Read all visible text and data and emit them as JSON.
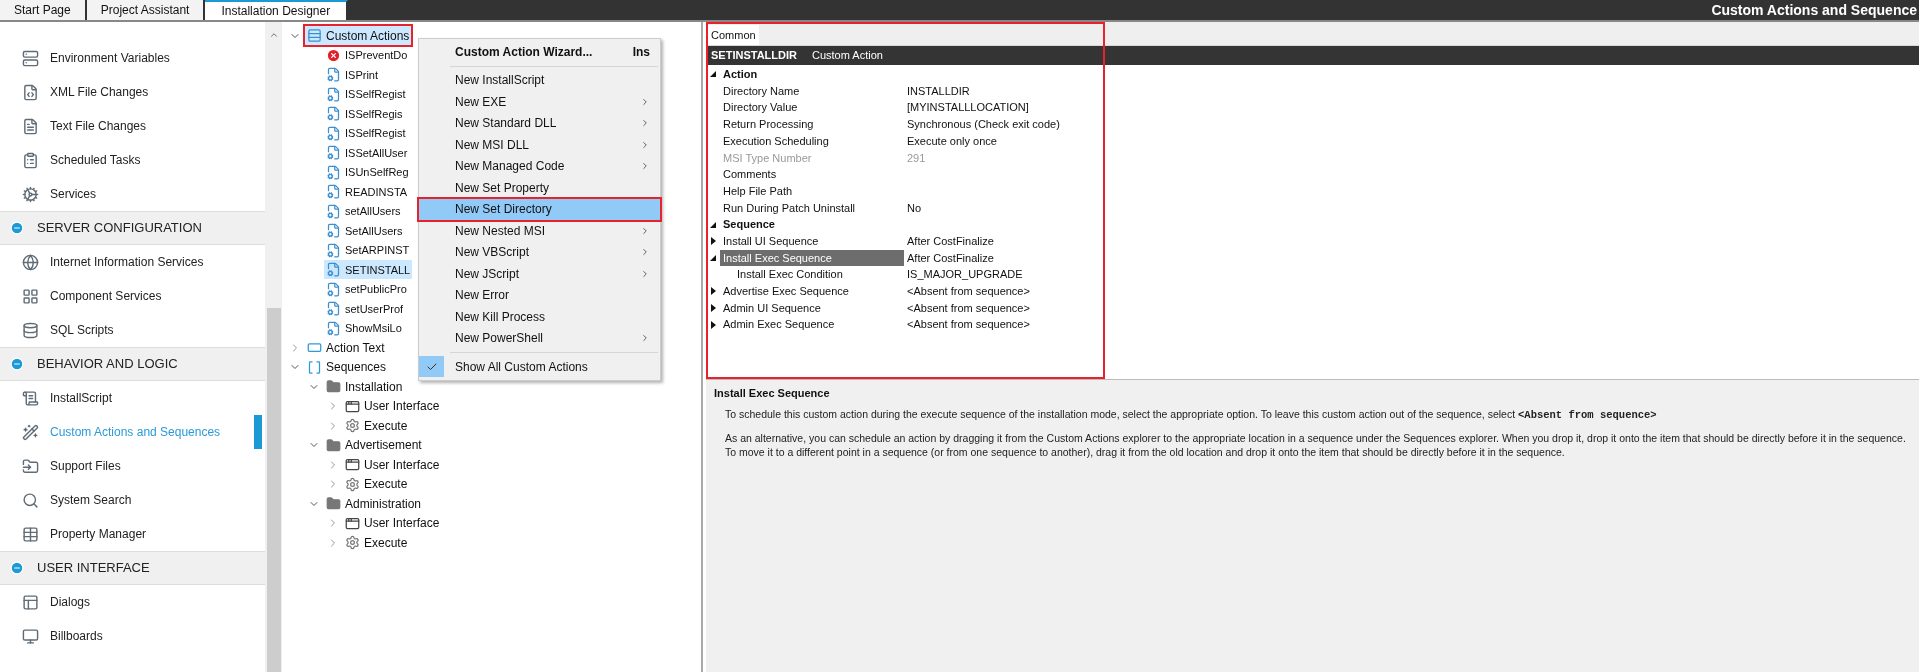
{
  "tabs": [
    {
      "label": "Start Page",
      "selected": false
    },
    {
      "label": "Project Assistant",
      "selected": false
    },
    {
      "label": "Installation Designer",
      "selected": true
    }
  ],
  "view_title": "Custom Actions and Sequence",
  "sidebar": {
    "groups": [
      {
        "items": [
          {
            "label": "Environment Variables",
            "selected": false
          },
          {
            "label": "XML File Changes",
            "selected": false
          },
          {
            "label": "Text File Changes",
            "selected": false
          },
          {
            "label": "Scheduled Tasks",
            "selected": false
          },
          {
            "label": "Services",
            "selected": false
          }
        ]
      },
      {
        "title": "SERVER CONFIGURATION",
        "expanded": true,
        "items": [
          {
            "label": "Internet Information Services",
            "selected": false
          },
          {
            "label": "Component Services",
            "selected": false
          },
          {
            "label": "SQL Scripts",
            "selected": false
          }
        ]
      },
      {
        "title": "BEHAVIOR AND LOGIC",
        "expanded": true,
        "items": [
          {
            "label": "InstallScript",
            "selected": false
          },
          {
            "label": "Custom Actions and Sequences",
            "selected": true
          },
          {
            "label": "Support Files",
            "selected": false
          },
          {
            "label": "System Search",
            "selected": false
          },
          {
            "label": "Property Manager",
            "selected": false
          }
        ]
      },
      {
        "title": "USER INTERFACE",
        "expanded": true,
        "items": [
          {
            "label": "Dialogs",
            "selected": false
          },
          {
            "label": "Billboards",
            "selected": false
          }
        ]
      }
    ]
  },
  "tree": [
    {
      "label": "Custom Actions",
      "expanded": true,
      "selected": true,
      "outlined": true,
      "children": [
        {
          "label": "ISPreventDo",
          "selected": false,
          "error": true
        },
        {
          "label": "ISPrint",
          "selected": false,
          "error": false
        },
        {
          "label": "ISSelfRegist",
          "selected": false,
          "error": false
        },
        {
          "label": "ISSelfRegis",
          "selected": false,
          "error": false
        },
        {
          "label": "ISSelfRegist",
          "selected": false,
          "error": false
        },
        {
          "label": "ISSetAllUser",
          "selected": false,
          "error": false
        },
        {
          "label": "ISUnSelfReg",
          "selected": false,
          "error": false
        },
        {
          "label": "READINSTA",
          "selected": false,
          "error": false
        },
        {
          "label": "setAllUsers",
          "selected": false,
          "error": false
        },
        {
          "label": "SetAllUsers",
          "selected": false,
          "error": false
        },
        {
          "label": "SetARPINST",
          "selected": false,
          "error": false
        },
        {
          "label": "SETINSTALL",
          "selected": true,
          "error": false
        },
        {
          "label": "setPublicPro",
          "selected": false,
          "error": false
        },
        {
          "label": "setUserProf",
          "selected": false,
          "error": false
        },
        {
          "label": "ShowMsiLo",
          "selected": false,
          "error": false
        }
      ]
    },
    {
      "label": "Action Text",
      "expanded": false,
      "selected": false,
      "outlined": false
    },
    {
      "label": "Sequences",
      "expanded": true,
      "selected": false,
      "outlined": false,
      "children": [
        {
          "label": "Installation",
          "expanded": true,
          "selected": false,
          "children": [
            {
              "label": "User Interface",
              "expanded": false,
              "selected": false
            },
            {
              "label": "Execute",
              "expanded": false,
              "selected": false
            }
          ]
        },
        {
          "label": "Advertisement",
          "expanded": true,
          "selected": false,
          "children": [
            {
              "label": "User Interface",
              "expanded": false,
              "selected": false
            },
            {
              "label": "Execute",
              "expanded": false,
              "selected": false
            }
          ]
        },
        {
          "label": "Administration",
          "expanded": true,
          "selected": false,
          "children": [
            {
              "label": "User Interface",
              "expanded": false,
              "selected": false
            },
            {
              "label": "Execute",
              "expanded": false,
              "selected": false
            }
          ]
        }
      ]
    }
  ],
  "context_menu": [
    {
      "kind": "item",
      "label": "Custom Action Wizard...",
      "shortcut": "Ins",
      "default": true,
      "submenu": false,
      "selected": false,
      "checked": false,
      "outlined": false
    },
    {
      "kind": "separator"
    },
    {
      "kind": "item",
      "label": "New InstallScript",
      "default": false,
      "submenu": false,
      "selected": false,
      "checked": false,
      "outlined": false
    },
    {
      "kind": "item",
      "label": "New EXE",
      "default": false,
      "submenu": true,
      "selected": false,
      "checked": false,
      "outlined": false
    },
    {
      "kind": "item",
      "label": "New Standard DLL",
      "default": false,
      "submenu": true,
      "selected": false,
      "checked": false,
      "outlined": false
    },
    {
      "kind": "item",
      "label": "New MSI DLL",
      "default": false,
      "submenu": true,
      "selected": false,
      "checked": false,
      "outlined": false
    },
    {
      "kind": "item",
      "label": "New Managed Code",
      "default": false,
      "submenu": true,
      "selected": false,
      "checked": false,
      "outlined": false
    },
    {
      "kind": "item",
      "label": "New Set Property",
      "default": false,
      "submenu": false,
      "selected": false,
      "checked": false,
      "outlined": false
    },
    {
      "kind": "item",
      "label": "New Set Directory",
      "default": false,
      "submenu": false,
      "selected": true,
      "checked": false,
      "outlined": true
    },
    {
      "kind": "item",
      "label": "New Nested MSI",
      "default": false,
      "submenu": true,
      "selected": false,
      "checked": false,
      "outlined": false
    },
    {
      "kind": "item",
      "label": "New VBScript",
      "default": false,
      "submenu": true,
      "selected": false,
      "checked": false,
      "outlined": false
    },
    {
      "kind": "item",
      "label": "New JScript",
      "default": false,
      "submenu": true,
      "selected": false,
      "checked": false,
      "outlined": false
    },
    {
      "kind": "item",
      "label": "New Error",
      "default": false,
      "submenu": false,
      "selected": false,
      "checked": false,
      "outlined": false
    },
    {
      "kind": "item",
      "label": "New Kill Process",
      "default": false,
      "submenu": false,
      "selected": false,
      "checked": false,
      "outlined": false
    },
    {
      "kind": "item",
      "label": "New PowerShell",
      "default": false,
      "submenu": true,
      "selected": false,
      "checked": false,
      "outlined": false
    },
    {
      "kind": "separator"
    },
    {
      "kind": "item",
      "label": "Show All Custom Actions",
      "default": false,
      "submenu": false,
      "selected": false,
      "checked": true,
      "outlined": false
    }
  ],
  "properties": {
    "outlined": true,
    "tabs": [
      {
        "label": "Common",
        "selected": true
      }
    ],
    "object_name": "SETINSTALLDIR",
    "object_type": "Custom Action",
    "categories": [
      {
        "name": "Action",
        "expanded": true,
        "rows": [
          {
            "name": "Directory Name",
            "value": "INSTALLDIR",
            "disabled": false,
            "selected": false
          },
          {
            "name": "Directory Value",
            "value": "[MYINSTALLLOCATION]",
            "disabled": false,
            "selected": false
          },
          {
            "name": "Return Processing",
            "value": "Synchronous (Check exit code)",
            "disabled": false,
            "selected": false
          },
          {
            "name": "Execution Scheduling",
            "value": "Execute only once",
            "disabled": false,
            "selected": false
          },
          {
            "name": "MSI Type Number",
            "value": "291",
            "disabled": true,
            "selected": false
          },
          {
            "name": "Comments",
            "disabled": false,
            "selected": false
          },
          {
            "name": "Help File Path",
            "disabled": false,
            "selected": false
          },
          {
            "name": "Run During Patch Uninstall",
            "value": "No",
            "disabled": false,
            "selected": false
          }
        ]
      },
      {
        "name": "Sequence",
        "expanded": true,
        "rows": [
          {
            "name": "Install UI Sequence",
            "value": "After CostFinalize",
            "disabled": false,
            "selected": false,
            "expanded": false
          },
          {
            "name": "Install Exec Sequence",
            "value": "After CostFinalize",
            "disabled": false,
            "selected": true,
            "expanded": true,
            "children": [
              {
                "name": "Install Exec Condition",
                "value": "IS_MAJOR_UPGRADE",
                "disabled": false,
                "selected": false
              }
            ]
          },
          {
            "name": "Advertise Exec Sequence",
            "value": "<Absent from sequence>",
            "disabled": false,
            "selected": false,
            "expanded": false
          },
          {
            "name": "Admin UI Sequence",
            "value": "<Absent from sequence>",
            "disabled": false,
            "selected": false,
            "expanded": false
          },
          {
            "name": "Admin Exec Sequence",
            "value": "<Absent from sequence>",
            "disabled": false,
            "selected": false,
            "expanded": false
          }
        ]
      }
    ]
  },
  "help": {
    "title": "Install Exec Sequence",
    "paragraphs": [
      {
        "text": "To schedule this custom action during the execute sequence of the installation mode, select the appropriate option. To leave this custom action out of the sequence, select",
        "code": "<Absent from sequence>"
      },
      {
        "text": "As an alternative, you can schedule an action by dragging it from the Custom Actions explorer to the appropriate location in a sequence under the Sequences explorer. When you drop it, drop it onto the item that should be directly before it in the sequence. To move it to a different point in a sequence (or from one sequence to another), drag it from the old location and drop it onto the item that should be directly before it in the sequence."
      }
    ]
  }
}
